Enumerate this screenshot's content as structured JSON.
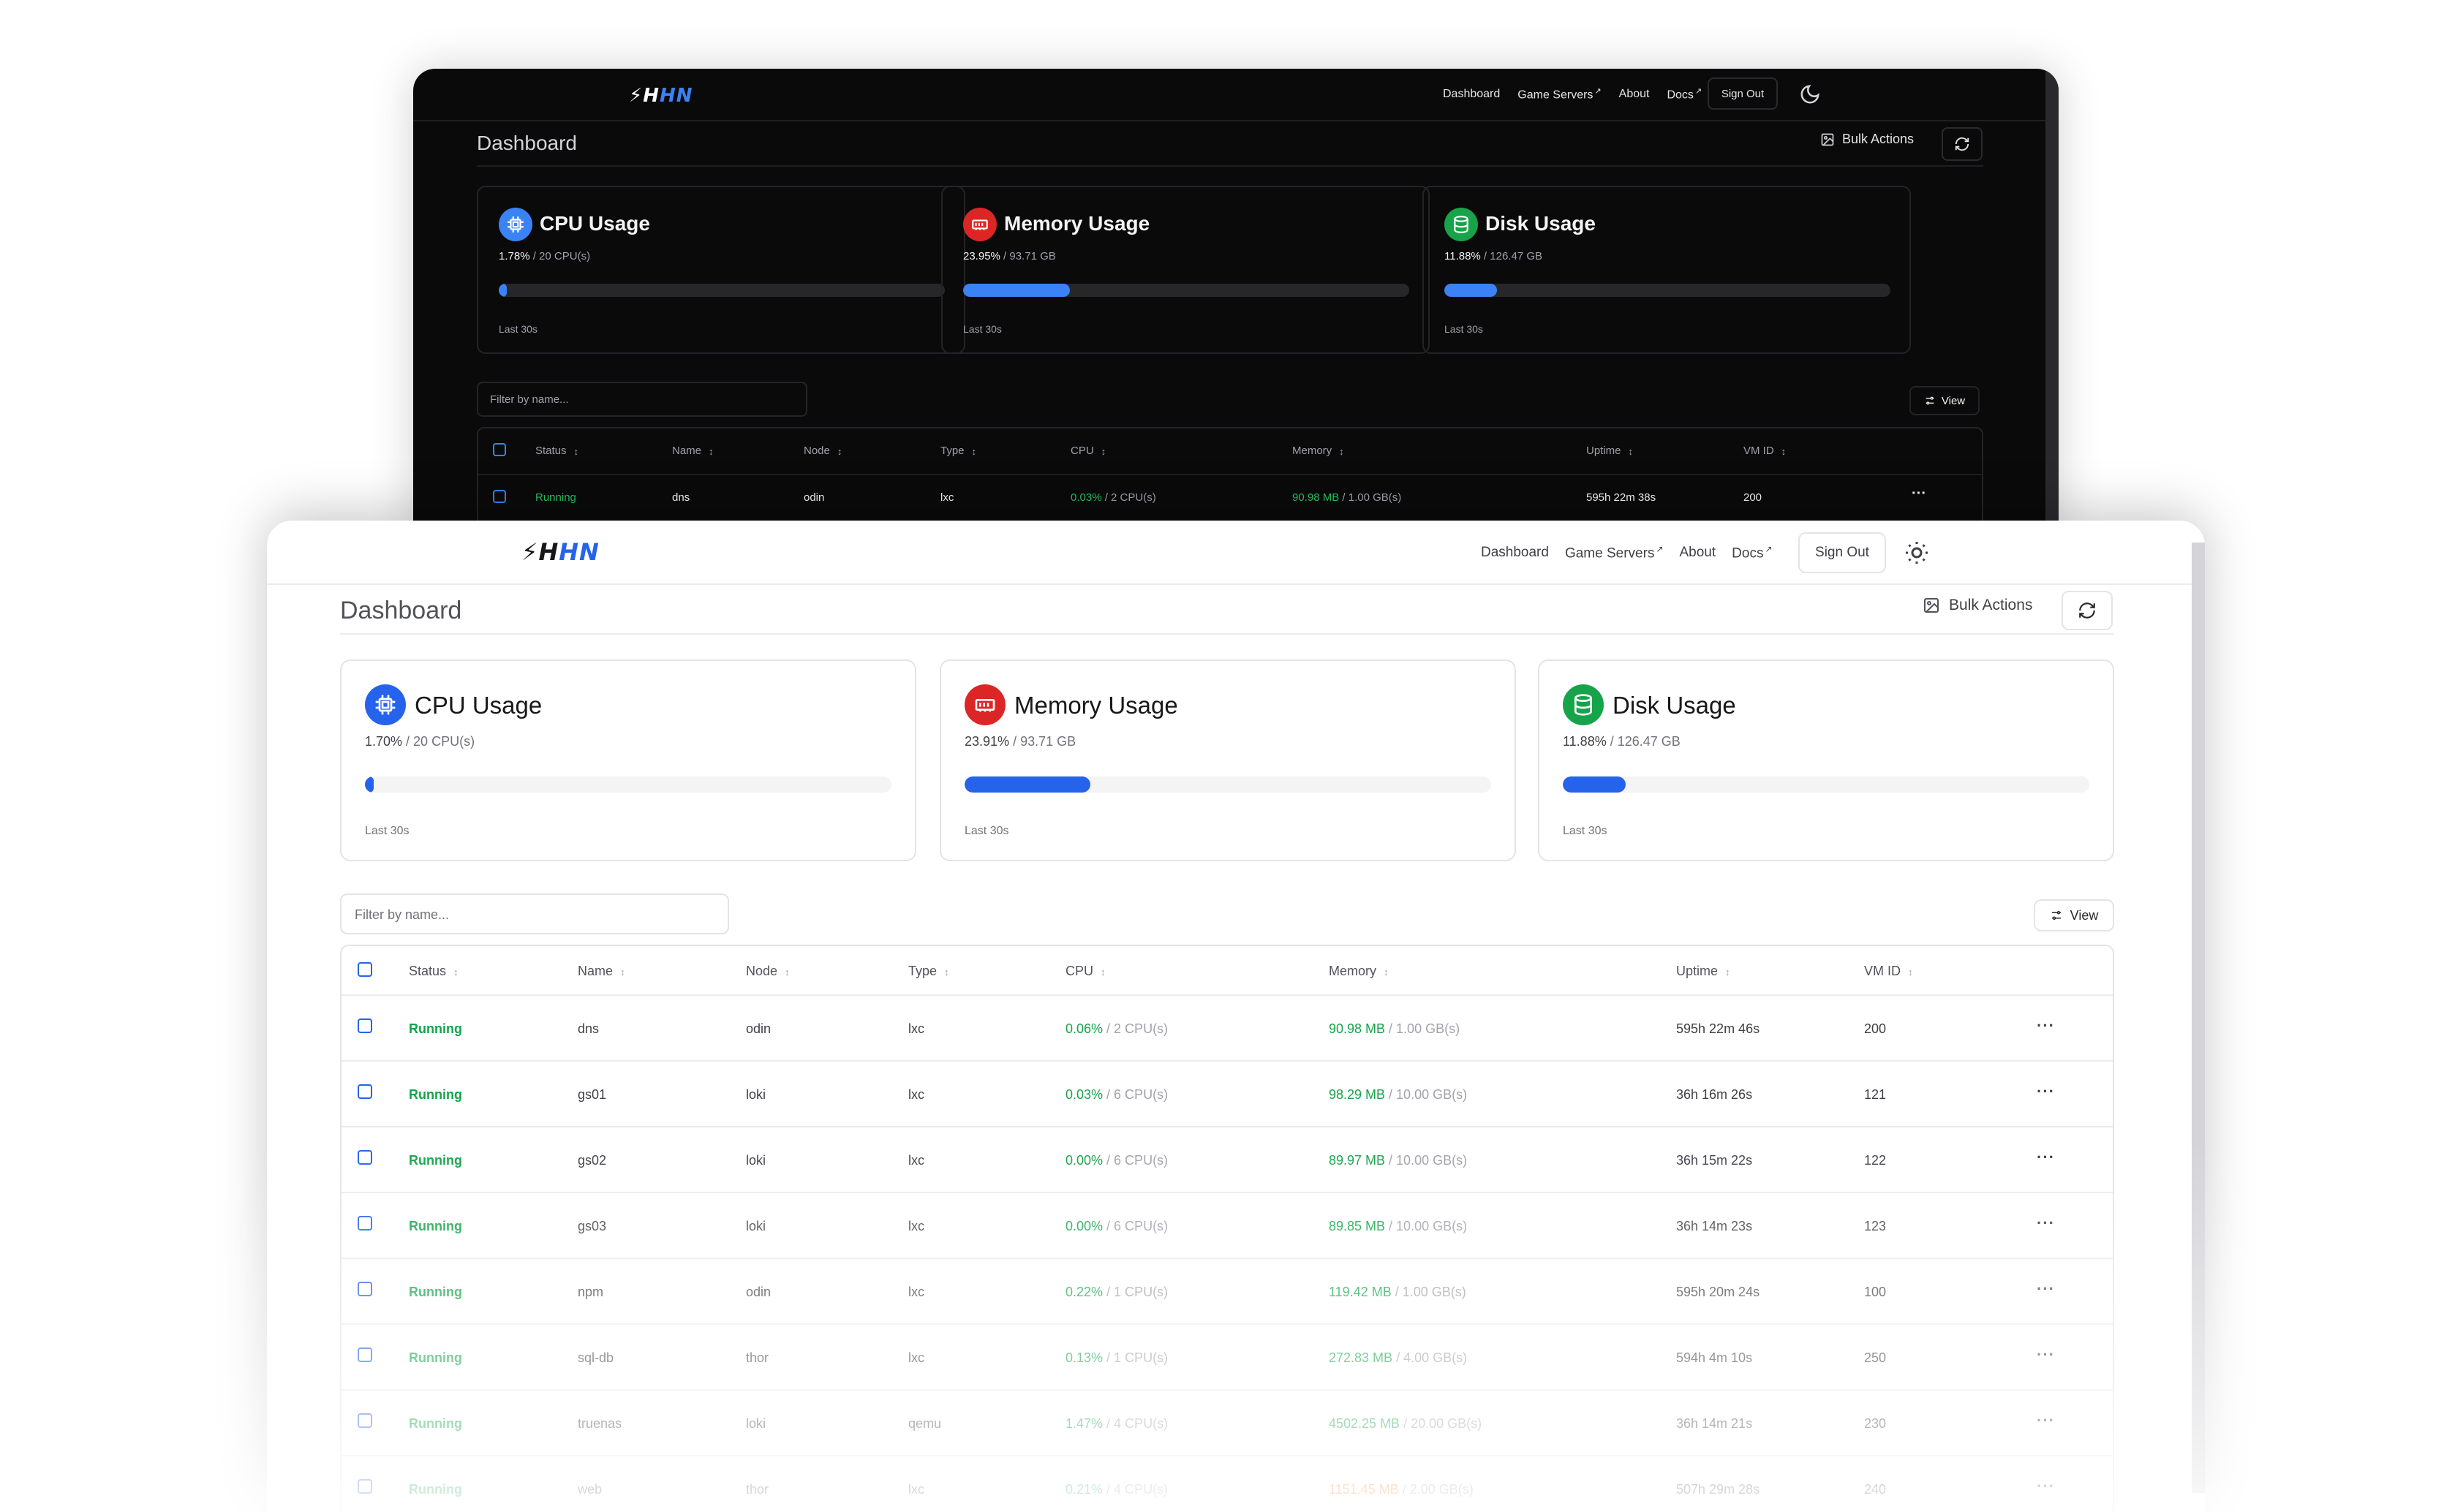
{
  "brand": {
    "logo_prefix": "⚡",
    "logo_h": "H",
    "logo_hn": "HN"
  },
  "nav": {
    "dashboard": "Dashboard",
    "game_servers": "Game Servers",
    "about": "About",
    "docs": "Docs",
    "ext_mark": "↗",
    "sign_out": "Sign Out"
  },
  "page": {
    "title": "Dashboard",
    "bulk_actions": "Bulk Actions",
    "filter_placeholder": "Filter by name...",
    "view": "View"
  },
  "colors": {
    "accent": "#2563eb",
    "running": "#16a34a",
    "cpu_icon": "#2563eb",
    "mem_icon": "#dc2626",
    "disk_icon": "#16a34a"
  },
  "dark": {
    "cards": [
      {
        "title": "CPU Usage",
        "value": "1.78%",
        "total": " / 20 CPU(s)",
        "fill": 0.0178,
        "footer": "Last 30s",
        "icon": "cpu-icon"
      },
      {
        "title": "Memory Usage",
        "value": "23.95%",
        "total": " / 93.71 GB",
        "fill": 0.2395,
        "footer": "Last 30s",
        "icon": "memory-icon"
      },
      {
        "title": "Disk Usage",
        "value": "11.88%",
        "total": " / 126.47 GB",
        "fill": 0.1188,
        "footer": "Last 30s",
        "icon": "disk-icon"
      }
    ],
    "row": {
      "status": "Running",
      "name": "dns",
      "node": "odin",
      "type": "lxc",
      "cpu": "0.03%",
      "cpu_total": " / 2 CPU(s)",
      "mem": "90.98 MB",
      "mem_total": " / 1.00 GB(s)",
      "uptime": "595h 22m 38s",
      "vmid": "200",
      "actions": "···"
    }
  },
  "light": {
    "cards": [
      {
        "title": "CPU Usage",
        "value": "1.70%",
        "total": " / 20 CPU(s)",
        "fill": 0.017,
        "footer": "Last 30s",
        "icon": "cpu-icon"
      },
      {
        "title": "Memory Usage",
        "value": "23.91%",
        "total": " / 93.71 GB",
        "fill": 0.2391,
        "footer": "Last 30s",
        "icon": "memory-icon"
      },
      {
        "title": "Disk Usage",
        "value": "11.88%",
        "total": " / 126.47 GB",
        "fill": 0.1188,
        "footer": "Last 30s",
        "icon": "disk-icon"
      }
    ]
  },
  "table": {
    "headers": {
      "status": "Status",
      "name": "Name",
      "node": "Node",
      "type": "Type",
      "cpu": "CPU",
      "memory": "Memory",
      "uptime": "Uptime",
      "vmid": "VM ID",
      "sort_icon": "↕"
    },
    "rows": [
      {
        "status": "Running",
        "name": "dns",
        "node": "odin",
        "type": "lxc",
        "cpu": "0.06%",
        "cpu_total": " / 2 CPU(s)",
        "mem": "90.98 MB",
        "mem_total": " / 1.00 GB(s)",
        "mem_color": "green",
        "uptime": "595h 22m 46s",
        "vmid": "200",
        "actions": "···"
      },
      {
        "status": "Running",
        "name": "gs01",
        "node": "loki",
        "type": "lxc",
        "cpu": "0.03%",
        "cpu_total": " / 6 CPU(s)",
        "mem": "98.29 MB",
        "mem_total": " / 10.00 GB(s)",
        "mem_color": "green",
        "uptime": "36h 16m 26s",
        "vmid": "121",
        "actions": "···"
      },
      {
        "status": "Running",
        "name": "gs02",
        "node": "loki",
        "type": "lxc",
        "cpu": "0.00%",
        "cpu_total": " / 6 CPU(s)",
        "mem": "89.97 MB",
        "mem_total": " / 10.00 GB(s)",
        "mem_color": "green",
        "uptime": "36h 15m 22s",
        "vmid": "122",
        "actions": "···"
      },
      {
        "status": "Running",
        "name": "gs03",
        "node": "loki",
        "type": "lxc",
        "cpu": "0.00%",
        "cpu_total": " / 6 CPU(s)",
        "mem": "89.85 MB",
        "mem_total": " / 10.00 GB(s)",
        "mem_color": "green",
        "uptime": "36h 14m 23s",
        "vmid": "123",
        "actions": "···"
      },
      {
        "status": "Running",
        "name": "npm",
        "node": "odin",
        "type": "lxc",
        "cpu": "0.22%",
        "cpu_total": " / 1 CPU(s)",
        "mem": "119.42 MB",
        "mem_total": " / 1.00 GB(s)",
        "mem_color": "green",
        "uptime": "595h 20m 24s",
        "vmid": "100",
        "actions": "···"
      },
      {
        "status": "Running",
        "name": "sql-db",
        "node": "thor",
        "type": "lxc",
        "cpu": "0.13%",
        "cpu_total": " / 1 CPU(s)",
        "mem": "272.83 MB",
        "mem_total": " / 4.00 GB(s)",
        "mem_color": "green",
        "uptime": "594h 4m 10s",
        "vmid": "250",
        "actions": "···"
      },
      {
        "status": "Running",
        "name": "truenas",
        "node": "loki",
        "type": "qemu",
        "cpu": "1.47%",
        "cpu_total": " / 4 CPU(s)",
        "mem": "4502.25 MB",
        "mem_total": " / 20.00 GB(s)",
        "mem_color": "green",
        "uptime": "36h 14m 21s",
        "vmid": "230",
        "actions": "···"
      },
      {
        "status": "Running",
        "name": "web",
        "node": "thor",
        "type": "lxc",
        "cpu": "0.21%",
        "cpu_total": " / 4 CPU(s)",
        "mem": "1151.45 MB",
        "mem_total": " / 2.00 GB(s)",
        "mem_color": "orange",
        "uptime": "507h 29m 28s",
        "vmid": "240",
        "actions": "···"
      }
    ]
  }
}
